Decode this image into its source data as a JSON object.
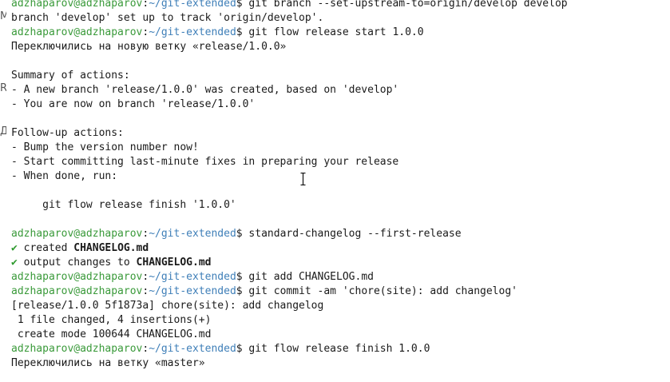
{
  "prompt": {
    "user": "adzhaparov@adzhaparov",
    "path": "~/git-extended",
    "symbol": "$"
  },
  "edge_fragments": [
    "M",
    "R",
    "Д"
  ],
  "lines": [
    {
      "kind": "prompt",
      "cmd": " git branch --set-upstream-to=origin/develop develop"
    },
    {
      "kind": "text",
      "text": "branch 'develop' set up to track 'origin/develop'."
    },
    {
      "kind": "prompt",
      "cmd": " git flow release start 1.0.0"
    },
    {
      "kind": "text",
      "text": "Переключились на новую ветку «release/1.0.0»"
    },
    {
      "kind": "text",
      "text": ""
    },
    {
      "kind": "text",
      "text": "Summary of actions:"
    },
    {
      "kind": "text",
      "text": "- A new branch 'release/1.0.0' was created, based on 'develop'"
    },
    {
      "kind": "text",
      "text": "- You are now on branch 'release/1.0.0'"
    },
    {
      "kind": "text",
      "text": ""
    },
    {
      "kind": "text",
      "text": "Follow-up actions:"
    },
    {
      "kind": "text",
      "text": "- Bump the version number now!"
    },
    {
      "kind": "text",
      "text": "- Start committing last-minute fixes in preparing your release"
    },
    {
      "kind": "text",
      "text": "- When done, run:"
    },
    {
      "kind": "text",
      "text": ""
    },
    {
      "kind": "text",
      "text": "     git flow release finish '1.0.0'"
    },
    {
      "kind": "text",
      "text": ""
    },
    {
      "kind": "prompt",
      "cmd": " standard-changelog --first-release"
    },
    {
      "kind": "check",
      "check": "✔",
      "text": " created ",
      "bold": "CHANGELOG.md"
    },
    {
      "kind": "check",
      "check": "✔",
      "text": " output changes to ",
      "bold": "CHANGELOG.md"
    },
    {
      "kind": "prompt",
      "cmd": " git add CHANGELOG.md"
    },
    {
      "kind": "prompt",
      "cmd": " git commit -am 'chore(site): add changelog'"
    },
    {
      "kind": "text",
      "text": "[release/1.0.0 5f1873a] chore(site): add changelog"
    },
    {
      "kind": "text",
      "text": " 1 file changed, 4 insertions(+)"
    },
    {
      "kind": "text",
      "text": " create mode 100644 CHANGELOG.md"
    },
    {
      "kind": "prompt",
      "cmd": " git flow release finish 1.0.0"
    },
    {
      "kind": "text",
      "text": "Переключились на ветку «master»"
    }
  ]
}
